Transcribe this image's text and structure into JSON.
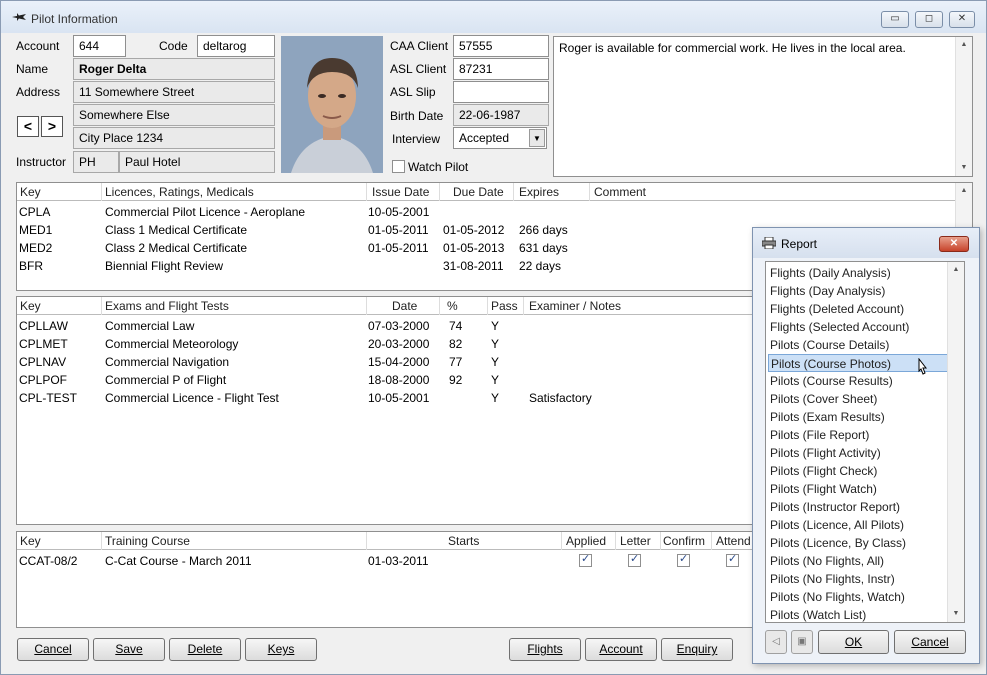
{
  "window": {
    "title": "Pilot Information",
    "controls": [
      "▭",
      "◻",
      "✕"
    ]
  },
  "pilot": {
    "account_label": "Account",
    "account": "644",
    "code_label": "Code",
    "code": "deltarog",
    "name_label": "Name",
    "name": "Roger Delta",
    "address_label": "Address",
    "address1": "11 Somewhere Street",
    "address2": "Somewhere Else",
    "address3": "City Place 1234",
    "instructor_label": "Instructor",
    "instructor_code": "PH",
    "instructor_name": "Paul Hotel",
    "prev": "<",
    "next": ">"
  },
  "caa": {
    "caa_client_label": "CAA Client",
    "caa_client": "57555",
    "asl_client_label": "ASL Client",
    "asl_client": "87231",
    "asl_slip_label": "ASL Slip",
    "asl_slip": "",
    "birth_label": "Birth Date",
    "birth": "22-06-1987",
    "interview_label": "Interview",
    "interview": "Accepted",
    "watch_label": "Watch Pilot"
  },
  "memo": "Roger is available for commercial work. He lives in the local area.",
  "licences": {
    "headers": [
      "Key",
      "Licences, Ratings, Medicals",
      "Issue Date",
      "Due Date",
      "Expires",
      "Comment"
    ],
    "rows": [
      [
        "CPLA",
        "Commercial Pilot Licence - Aeroplane",
        "10-05-2001",
        "",
        "",
        ""
      ],
      [
        "MED1",
        "Class 1 Medical Certificate",
        "01-05-2011",
        "01-05-2012",
        "266 days",
        ""
      ],
      [
        "MED2",
        "Class 2 Medical Certificate",
        "01-05-2011",
        "01-05-2013",
        "631 days",
        ""
      ],
      [
        "BFR",
        "Biennial Flight Review",
        "",
        "31-08-2011",
        "22 days",
        ""
      ]
    ]
  },
  "exams": {
    "headers": [
      "Key",
      "Exams and Flight Tests",
      "Date",
      "%",
      "Pass",
      "Examiner / Notes"
    ],
    "rows": [
      [
        "CPLLAW",
        "Commercial Law",
        "07-03-2000",
        "74",
        "Y",
        ""
      ],
      [
        "CPLMET",
        "Commercial Meteorology",
        "20-03-2000",
        "82",
        "Y",
        ""
      ],
      [
        "CPLNAV",
        "Commercial Navigation",
        "15-04-2000",
        "77",
        "Y",
        ""
      ],
      [
        "CPLPOF",
        "Commercial P of Flight",
        "18-08-2000",
        "92",
        "Y",
        ""
      ],
      [
        "CPL-TEST",
        "Commercial Licence - Flight Test",
        "10-05-2001",
        "",
        "Y",
        "Satisfactory"
      ]
    ]
  },
  "courses": {
    "headers": [
      "Key",
      "Training Course",
      "Starts",
      "Applied",
      "Letter",
      "Confirm",
      "Attend"
    ],
    "rows": [
      [
        "CCAT-08/2",
        "C-Cat Course - March 2011",
        "01-03-2011"
      ]
    ]
  },
  "buttons": {
    "cancel": "Cancel",
    "save": "Save",
    "delete": "Delete",
    "keys": "Keys",
    "flights": "Flights",
    "account": "Account",
    "enquiry": "Enquiry"
  },
  "report": {
    "title": "Report",
    "close": "✕",
    "items": [
      "Flights (Daily Analysis)",
      "Flights (Day Analysis)",
      "Flights (Deleted Account)",
      "Flights (Selected Account)",
      "Pilots (Course Details)",
      "Pilots (Course Photos)",
      "Pilots (Course Results)",
      "Pilots (Cover Sheet)",
      "Pilots (Exam Results)",
      "Pilots (File Report)",
      "Pilots (Flight Activity)",
      "Pilots (Flight Check)",
      "Pilots (Flight Watch)",
      "Pilots (Instructor Report)",
      "Pilots (Licence, All Pilots)",
      "Pilots (Licence, By Class)",
      "Pilots (No Flights, All)",
      "Pilots (No Flights, Instr)",
      "Pilots (No Flights, Watch)",
      "Pilots (Watch List)"
    ],
    "selected_index": 5,
    "ok": "OK",
    "cancel": "Cancel",
    "back_icon": "◁",
    "save_icon": "▣"
  }
}
